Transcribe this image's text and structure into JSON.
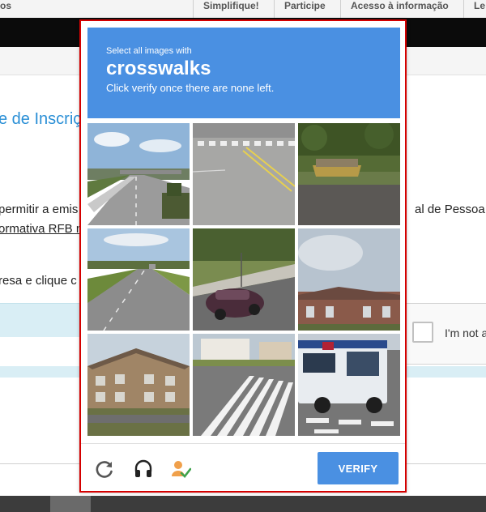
{
  "nav": {
    "items": [
      "os",
      "Simplifique!",
      "Participe",
      "Acesso à informação",
      "Le"
    ]
  },
  "page": {
    "title": "e de Inscriç",
    "line1_left": "permitir a emis",
    "line1_right": "al de Pessoa J",
    "line2": "ormativa RFB n",
    "line3": "resa e clique c"
  },
  "recaptcha_widget": {
    "label": "I'm not a"
  },
  "captcha": {
    "instruction_pre": "Select all images with",
    "keyword": "crosswalks",
    "instruction_post": "Click verify once there are none left.",
    "tiles": [
      "highway-with-overpass",
      "road-intersection-markings",
      "dumpster-by-road",
      "rural-road",
      "car-on-street-corner",
      "building-under-cloudy-sky",
      "apartment-buildings",
      "crosswalk-on-street",
      "city-bus-at-crosswalk"
    ],
    "verify_label": "VERIFY",
    "icons": [
      "reload-icon",
      "audio-headphones-icon",
      "info-person-check-icon"
    ],
    "colors": {
      "header": "#4a90e2",
      "verify": "#4a90e2",
      "border": "#d40000"
    }
  }
}
